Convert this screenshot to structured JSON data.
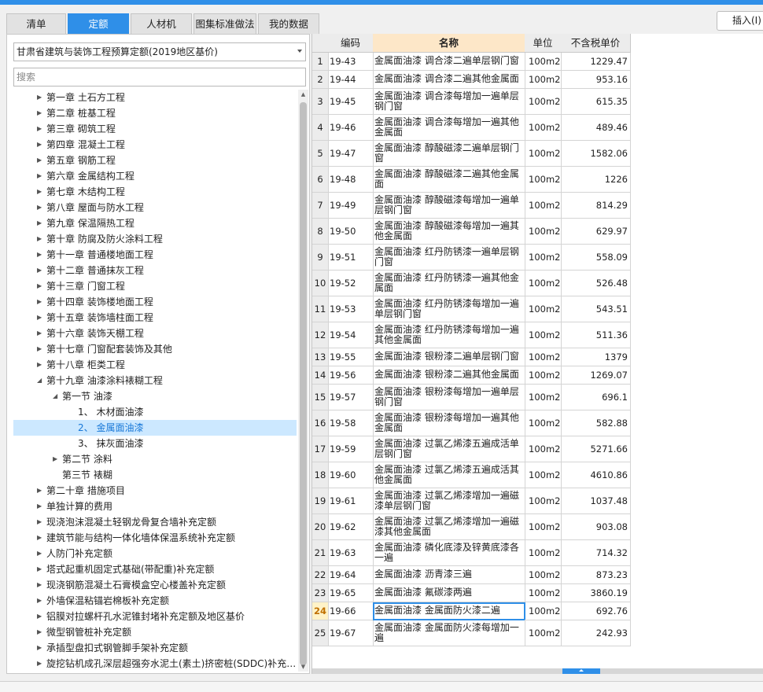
{
  "tabs": [
    "清单",
    "定额",
    "人材机",
    "图集标准做法",
    "我的数据"
  ],
  "active_tab_index": 1,
  "insert_button": "插入(I)",
  "library": {
    "selected": "甘肃省建筑与装饰工程预算定额(2019地区基价)"
  },
  "search": {
    "placeholder": "搜索",
    "value": ""
  },
  "tree": [
    {
      "label": "第一章 土石方工程",
      "level": 0,
      "expander": "collapsed"
    },
    {
      "label": "第二章 桩基工程",
      "level": 0,
      "expander": "collapsed"
    },
    {
      "label": "第三章 砌筑工程",
      "level": 0,
      "expander": "collapsed"
    },
    {
      "label": "第四章 混凝土工程",
      "level": 0,
      "expander": "collapsed"
    },
    {
      "label": "第五章 钢筋工程",
      "level": 0,
      "expander": "collapsed"
    },
    {
      "label": "第六章 金属结构工程",
      "level": 0,
      "expander": "collapsed"
    },
    {
      "label": "第七章 木结构工程",
      "level": 0,
      "expander": "collapsed"
    },
    {
      "label": "第八章 屋面与防水工程",
      "level": 0,
      "expander": "collapsed"
    },
    {
      "label": "第九章 保温隔热工程",
      "level": 0,
      "expander": "collapsed"
    },
    {
      "label": "第十章 防腐及防火涂料工程",
      "level": 0,
      "expander": "collapsed"
    },
    {
      "label": "第十一章 普通楼地面工程",
      "level": 0,
      "expander": "collapsed"
    },
    {
      "label": "第十二章 普通抹灰工程",
      "level": 0,
      "expander": "collapsed"
    },
    {
      "label": "第十三章 门窗工程",
      "level": 0,
      "expander": "collapsed"
    },
    {
      "label": "第十四章 装饰楼地面工程",
      "level": 0,
      "expander": "collapsed"
    },
    {
      "label": "第十五章 装饰墙柱面工程",
      "level": 0,
      "expander": "collapsed"
    },
    {
      "label": "第十六章 装饰天棚工程",
      "level": 0,
      "expander": "collapsed"
    },
    {
      "label": "第十七章 门窗配套装饰及其他",
      "level": 0,
      "expander": "collapsed"
    },
    {
      "label": "第十八章 柜类工程",
      "level": 0,
      "expander": "collapsed"
    },
    {
      "label": "第十九章 油漆涂料裱糊工程",
      "level": 0,
      "expander": "expanded"
    },
    {
      "label": "第一节 油漆",
      "level": 1,
      "expander": "expanded"
    },
    {
      "label": "1、 木材面油漆",
      "level": 2,
      "expander": "none"
    },
    {
      "label": "2、 金属面油漆",
      "level": 2,
      "expander": "none",
      "selected": true
    },
    {
      "label": "3、 抹灰面油漆",
      "level": 2,
      "expander": "none"
    },
    {
      "label": "第二节 涂料",
      "level": 1,
      "expander": "collapsed"
    },
    {
      "label": "第三节 裱糊",
      "level": 1,
      "expander": "none"
    },
    {
      "label": "第二十章 措施项目",
      "level": 0,
      "expander": "collapsed"
    },
    {
      "label": "单独计算的费用",
      "level": 0,
      "expander": "collapsed"
    },
    {
      "label": "现浇泡沫混凝土轻钢龙骨复合墙补充定额",
      "level": 0,
      "expander": "collapsed"
    },
    {
      "label": "建筑节能与结构一体化墙体保温系统补充定额",
      "level": 0,
      "expander": "collapsed"
    },
    {
      "label": "人防门补充定额",
      "level": 0,
      "expander": "collapsed"
    },
    {
      "label": "塔式起重机固定式基础(带配重)补充定额",
      "level": 0,
      "expander": "collapsed"
    },
    {
      "label": "现浇钢筋混凝土石膏模盒空心楼盖补充定额",
      "level": 0,
      "expander": "collapsed"
    },
    {
      "label": "外墙保温粘锚岩棉板补充定额",
      "level": 0,
      "expander": "collapsed"
    },
    {
      "label": "铝膜对拉螺杆孔水泥锥封堵补充定额及地区基价",
      "level": 0,
      "expander": "collapsed"
    },
    {
      "label": "微型钢管桩补充定额",
      "level": 0,
      "expander": "collapsed"
    },
    {
      "label": "承插型盘扣式钢管脚手架补充定额",
      "level": 0,
      "expander": "collapsed"
    },
    {
      "label": "旋挖钻机成孔深层超强夯水泥土(素土)挤密桩(SDDC)补充…",
      "level": 0,
      "expander": "collapsed"
    }
  ],
  "grid": {
    "columns": [
      "",
      "编码",
      "名称",
      "单位",
      "不含税单价"
    ],
    "current_row": 24,
    "rows": [
      {
        "no": "1",
        "code": "19-43",
        "name": "金属面油漆 调合漆二遍单层钢门窗",
        "unit": "100m2",
        "price": "1229.47"
      },
      {
        "no": "2",
        "code": "19-44",
        "name": "金属面油漆 调合漆二遍其他金属面",
        "unit": "100m2",
        "price": "953.16"
      },
      {
        "no": "3",
        "code": "19-45",
        "name": "金属面油漆 调合漆每增加一遍单层钢门窗",
        "unit": "100m2",
        "price": "615.35"
      },
      {
        "no": "4",
        "code": "19-46",
        "name": "金属面油漆 调合漆每增加一遍其他金属面",
        "unit": "100m2",
        "price": "489.46"
      },
      {
        "no": "5",
        "code": "19-47",
        "name": "金属面油漆 醇酸磁漆二遍单层钢门窗",
        "unit": "100m2",
        "price": "1582.06"
      },
      {
        "no": "6",
        "code": "19-48",
        "name": "金属面油漆 醇酸磁漆二遍其他金属面",
        "unit": "100m2",
        "price": "1226"
      },
      {
        "no": "7",
        "code": "19-49",
        "name": "金属面油漆 醇酸磁漆每增加一遍单层钢门窗",
        "unit": "100m2",
        "price": "814.29"
      },
      {
        "no": "8",
        "code": "19-50",
        "name": "金属面油漆 醇酸磁漆每增加一遍其他金属面",
        "unit": "100m2",
        "price": "629.97"
      },
      {
        "no": "9",
        "code": "19-51",
        "name": "金属面油漆 红丹防锈漆一遍单层钢门窗",
        "unit": "100m2",
        "price": "558.09"
      },
      {
        "no": "10",
        "code": "19-52",
        "name": "金属面油漆 红丹防锈漆一遍其他金属面",
        "unit": "100m2",
        "price": "526.48"
      },
      {
        "no": "11",
        "code": "19-53",
        "name": "金属面油漆 红丹防锈漆每增加一遍单层钢门窗",
        "unit": "100m2",
        "price": "543.51"
      },
      {
        "no": "12",
        "code": "19-54",
        "name": "金属面油漆 红丹防锈漆每增加一遍其他金属面",
        "unit": "100m2",
        "price": "511.36"
      },
      {
        "no": "13",
        "code": "19-55",
        "name": "金属面油漆 银粉漆二遍单层钢门窗",
        "unit": "100m2",
        "price": "1379"
      },
      {
        "no": "14",
        "code": "19-56",
        "name": "金属面油漆 银粉漆二遍其他金属面",
        "unit": "100m2",
        "price": "1269.07"
      },
      {
        "no": "15",
        "code": "19-57",
        "name": "金属面油漆 银粉漆每增加一遍单层钢门窗",
        "unit": "100m2",
        "price": "696.1"
      },
      {
        "no": "16",
        "code": "19-58",
        "name": "金属面油漆 银粉漆每增加一遍其他金属面",
        "unit": "100m2",
        "price": "582.88"
      },
      {
        "no": "17",
        "code": "19-59",
        "name": "金属面油漆 过氯乙烯漆五遍成活单层钢门窗",
        "unit": "100m2",
        "price": "5271.66"
      },
      {
        "no": "18",
        "code": "19-60",
        "name": "金属面油漆 过氯乙烯漆五遍成活其他金属面",
        "unit": "100m2",
        "price": "4610.86"
      },
      {
        "no": "19",
        "code": "19-61",
        "name": "金属面油漆 过氯乙烯漆增加一遍磁漆单层钢门窗",
        "unit": "100m2",
        "price": "1037.48"
      },
      {
        "no": "20",
        "code": "19-62",
        "name": "金属面油漆 过氯乙烯漆增加一遍磁漆其他金属面",
        "unit": "100m2",
        "price": "903.08"
      },
      {
        "no": "21",
        "code": "19-63",
        "name": "金属面油漆 磷化底漆及锌黄底漆各一遍",
        "unit": "100m2",
        "price": "714.32"
      },
      {
        "no": "22",
        "code": "19-64",
        "name": "金属面油漆 沥青漆三遍",
        "unit": "100m2",
        "price": "873.23"
      },
      {
        "no": "23",
        "code": "19-65",
        "name": "金属面油漆 氟碳漆两遍",
        "unit": "100m2",
        "price": "3860.19"
      },
      {
        "no": "24",
        "code": "19-66",
        "name": "金属面油漆 金属面防火漆二遍",
        "unit": "100m2",
        "price": "692.76"
      },
      {
        "no": "25",
        "code": "19-67",
        "name": "金属面油漆 金属面防火漆每增加一遍",
        "unit": "100m2",
        "price": "242.93"
      }
    ]
  }
}
